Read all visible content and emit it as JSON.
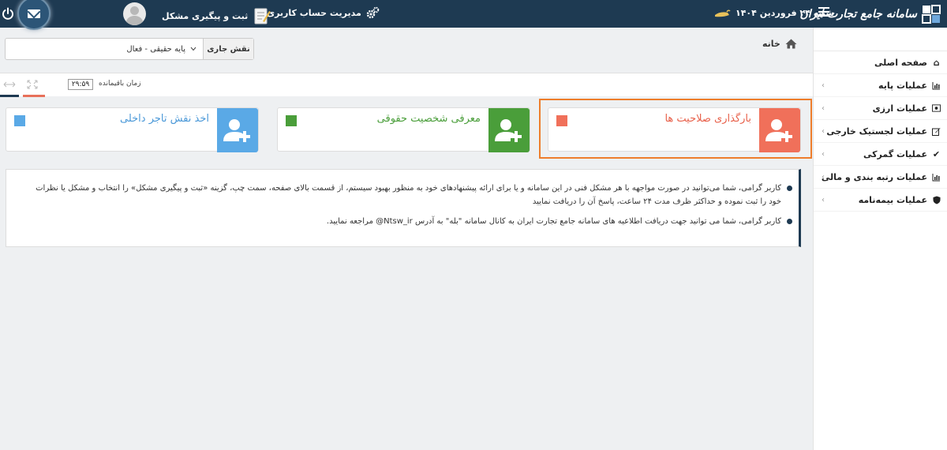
{
  "topbar": {
    "logo_text": "سامانه جامع تجارت ایران",
    "date": "شنبه ۲۴ فروردین ۱۴۰۴",
    "account_label": "مدیریت حساب کاربری",
    "ticket_label": "ثبت و پیگیری مشکل"
  },
  "breadcrumb": {
    "home_label": "خانه"
  },
  "role": {
    "label": "نقش جاری",
    "value": "پایه حقیقی - فعال"
  },
  "timer": {
    "label": "زمان باقیمانده",
    "value": "۲۹:۵۹"
  },
  "sidebar": {
    "items": [
      {
        "label": "صفحه اصلی",
        "icon": "home-icon",
        "has_chevron": false
      },
      {
        "label": "عملیات پایه",
        "icon": "chart-icon",
        "has_chevron": true
      },
      {
        "label": "عملیات ارزی",
        "icon": "money-icon",
        "has_chevron": true
      },
      {
        "label": "عملیات لجستیک خارجی",
        "icon": "edit-icon",
        "has_chevron": true
      },
      {
        "label": "عملیات گمرکی",
        "icon": "check-icon",
        "has_chevron": true
      },
      {
        "label": "عملیات رتبه بندی و مالی",
        "icon": "chart-icon",
        "has_chevron": true
      },
      {
        "label": "عملیات بیمه‌نامه",
        "icon": "shield-icon",
        "has_chevron": true
      }
    ]
  },
  "cards": [
    {
      "title": "بارگذاری صلاحیت ها",
      "color": "#f0705a"
    },
    {
      "title": "معرفی شخصیت حقوقی",
      "color": "#4a9e3a"
    },
    {
      "title": "اخذ نقش تاجر داخلی",
      "color": "#5aa9e6"
    }
  ],
  "notices": [
    "کاربر گرامی، شما می‌توانید در صورت مواجهه با هر مشکل فنی در این سامانه و یا برای ارائه پیشنهادهای خود به منظور بهبود سیستم، از قسمت بالای صفحه، سمت چپ، گزینه «ثبت و پیگیری مشکل» را انتخاب و مشکل یا نظرات خود را ثبت نموده و حداکثر ظرف مدت ۲۴ ساعت، پاسخ آن را دریافت نمایید",
    "کاربر گرامی، شما می توانید جهت دریافت اطلاعیه های سامانه جامع تجارت ایران به کانال سامانه \"بله\" به آدرس Ntsw_ir@ مراجعه نمایید."
  ],
  "colors": {
    "header": "#1e3a52",
    "highlight": "#ee7d2b"
  }
}
